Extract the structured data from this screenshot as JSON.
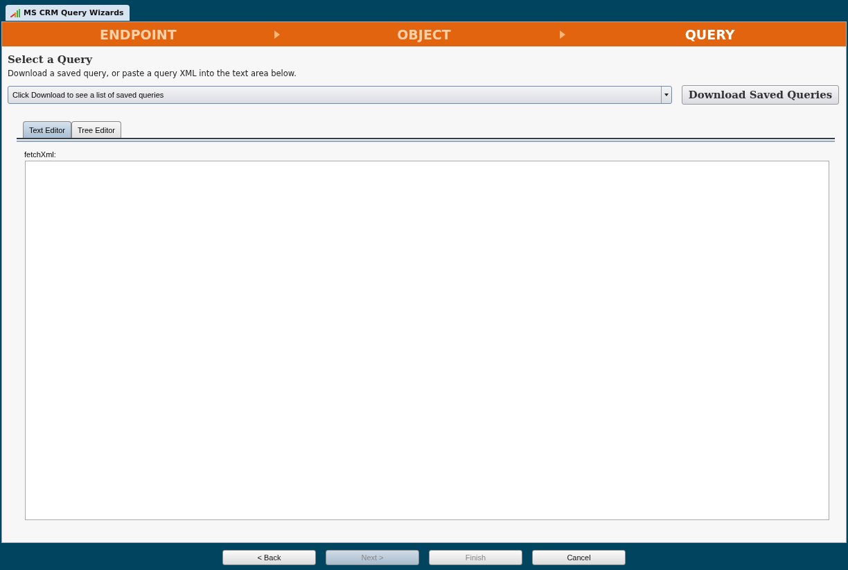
{
  "window": {
    "title": "MS CRM Query Wizards"
  },
  "steps": [
    {
      "label": "ENDPOINT",
      "selected": false
    },
    {
      "label": "OBJECT",
      "selected": false
    },
    {
      "label": "QUERY",
      "selected": true
    }
  ],
  "heading": "Select a Query",
  "description": "Download a saved query, or paste a query XML into the text area below.",
  "query_select": {
    "value": "Click Download to see a list of saved queries"
  },
  "download_button": "Download Saved Queries",
  "tabs": [
    {
      "label": "Text Editor",
      "selected": true
    },
    {
      "label": "Tree Editor",
      "selected": false
    }
  ],
  "editor": {
    "label": "fetchXml:"
  },
  "buttons": [
    {
      "label": "< Back",
      "disabled": false,
      "highlighted": false
    },
    {
      "label": "Next >",
      "disabled": true,
      "highlighted": true
    },
    {
      "label": "Finish",
      "disabled": true,
      "highlighted": false
    },
    {
      "label": "Cancel",
      "disabled": false,
      "highlighted": false
    }
  ]
}
